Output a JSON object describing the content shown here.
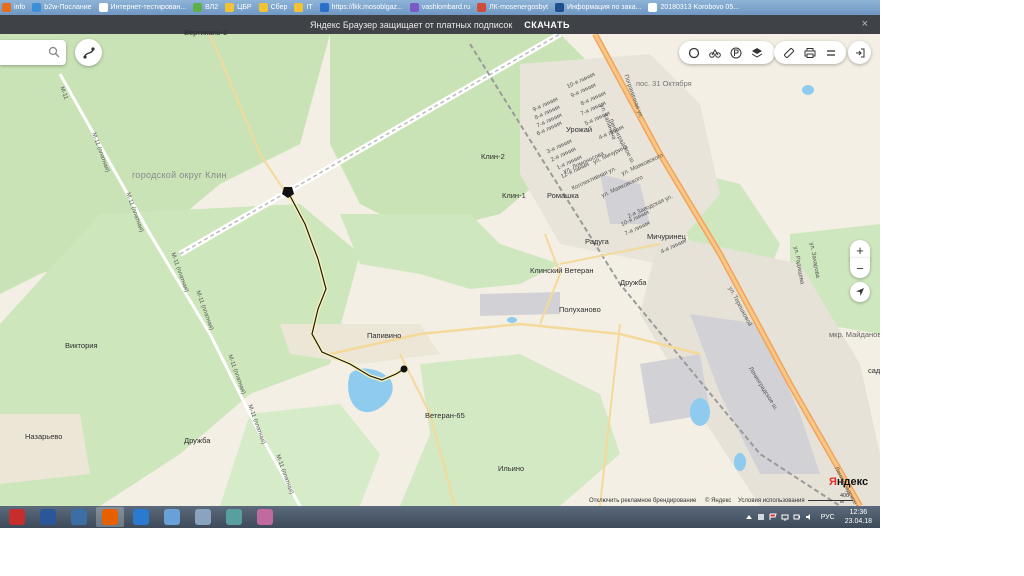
{
  "bookmarks": [
    {
      "label": "info",
      "color": "#e86c1c"
    },
    {
      "label": "b2w-Послание",
      "color": "#3a8fd8"
    },
    {
      "label": "Интернет-тестирован...",
      "color": "#ffffff"
    },
    {
      "label": "ВЛ2",
      "color": "#5fb04a"
    },
    {
      "label": "ЦБР",
      "color": "#f1c232"
    },
    {
      "label": "Сбер",
      "color": "#f1c232"
    },
    {
      "label": "IT",
      "color": "#f1c232"
    },
    {
      "label": "https://lkk.mosoblgaz...",
      "color": "#2a70c8"
    },
    {
      "label": "vashlombard.ru",
      "color": "#7c57c6"
    },
    {
      "label": "ЛК-mosenergosbyt",
      "color": "#d24b3a"
    },
    {
      "label": "Информация по зака...",
      "color": "#1f4e8c"
    },
    {
      "label": "20180313 Korobovo 05...",
      "color": "#ffffff"
    }
  ],
  "notification": {
    "text": "Яндекс Браузер защищает от платных подписок",
    "action": "СКАЧАТЬ",
    "close": "×"
  },
  "map": {
    "district": "городской округ Клин",
    "places": {
      "vertikal": "Вертикаль-2",
      "pos31": "пос. 31 Октября",
      "urozhay": "Урожай",
      "klin2": "Клин-2",
      "klin1": "Клин-1",
      "romashka": "Ромашка",
      "raduga": "Радуга",
      "michurinets": "Мичуринец",
      "klinskiy_veteran": "Клинский Ветеран",
      "druzhba_e": "Дружба",
      "poluhanovo": "Полуханово",
      "papivino": "Папивино",
      "viktoriya": "Виктория",
      "veteran65": "Ветеран-65",
      "nazarevo": "Назарьево",
      "druzhba_w": "Дружба",
      "ilino": "Ильино",
      "maydanovo": "мкр. Майданово",
      "sad": "сад"
    },
    "streets": {
      "leningradskoe1": "Ленинградское ш.",
      "leningradskoe2": "Ленинградское ш.",
      "tereshkovoy": "ул. Терешковой",
      "m11": "М-11 (платная)",
      "m11_short": "М-11",
      "lines": [
        "10-я линия",
        "9-я линия",
        "8-я линия",
        "7-я линия",
        "6-я линия",
        "5-я линия",
        "4-я линия",
        "3-я линия",
        "2-я линия",
        "1-я линия",
        "12-я линия",
        "11-я линия"
      ],
      "mayakovskogo": "ул. Маяковского",
      "lomonosova": "ул. Ломоносова",
      "michurina": "ул. Мичурина",
      "kollektivnaya": "Коллективная ул.",
      "zavodskaya": "2-я Заводская ул.",
      "radischeva": "ул. Радищева",
      "zaharova": "ул. Захарова",
      "kalinina": "ул. Калинина",
      "pogranichnaya": "Пограничная ул."
    },
    "footer": {
      "disable_branding": "Отключить рекламное брендирование",
      "copyright": "© Яндекс",
      "terms": "Условия использования",
      "scale": "400 м"
    },
    "logo_prefix": "Я",
    "logo_rest": "ндекс"
  },
  "taskbar": {
    "apps": [
      {
        "name": "app-pinned-1",
        "color": "#c62d2d",
        "active": false
      },
      {
        "name": "app-word",
        "color": "#2b579a",
        "active": false
      },
      {
        "name": "app-thunderbird",
        "color": "#3a6ea5",
        "active": false
      },
      {
        "name": "app-firefox",
        "color": "#e66000",
        "active": true
      },
      {
        "name": "app-navigator",
        "color": "#2a7bd0",
        "active": false
      },
      {
        "name": "app-notepad",
        "color": "#6aa0d8",
        "active": false
      },
      {
        "name": "app-calculator",
        "color": "#8aa4c0",
        "active": false
      },
      {
        "name": "app-maps",
        "color": "#58a0a0",
        "active": false
      },
      {
        "name": "app-people",
        "color": "#c06aa0",
        "active": false
      }
    ],
    "language": "РУС",
    "time": "12:36",
    "date": "23.04.18"
  }
}
